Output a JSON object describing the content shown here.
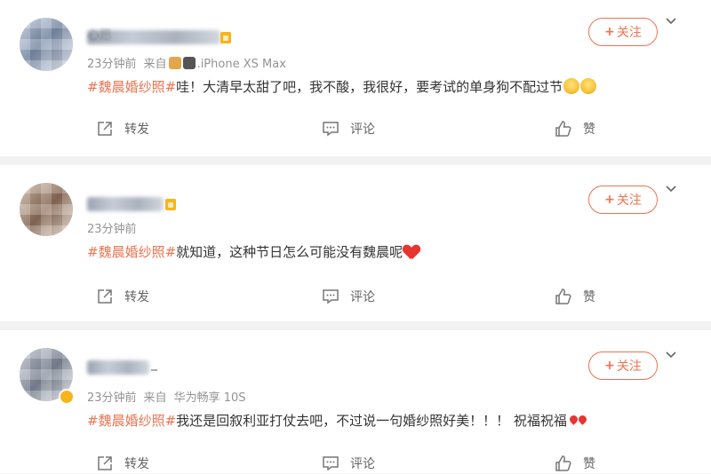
{
  "follow_label": "关注",
  "follow_plus": "+",
  "actions": {
    "share": "转发",
    "comment": "评论",
    "like": "赞"
  },
  "posts": [
    {
      "time": "23分钟前",
      "source_prefix": "来自",
      "source": ".iPhone XS Max",
      "hashtag": "#魏晨婚纱照#",
      "text": "哇！大清早太甜了吧，我不酸，我很好，要考试的单身狗不配过节",
      "name_fragment": "心愿"
    },
    {
      "time": "23分钟前",
      "hashtag": "#魏晨婚纱照#",
      "text": "就知道，这种节日怎么可能没有魏晨呢"
    },
    {
      "time": "23分钟前",
      "source_prefix": "来自",
      "source": "华为畅享 10S",
      "hashtag": "#魏晨婚纱照#",
      "text": "我还是回叙利亚打仗去吧，不过说一句婚纱照好美！！！ 祝福祝福",
      "name_fragment": "_"
    }
  ],
  "icons": {
    "share": "share-icon",
    "comment": "comment-icon",
    "like": "thumbs-up-icon",
    "chevron": "chevron-down-icon"
  },
  "colors": {
    "accent": "#eb7350",
    "meta": "#939393",
    "text": "#333333",
    "background": "#f2f2f2"
  }
}
